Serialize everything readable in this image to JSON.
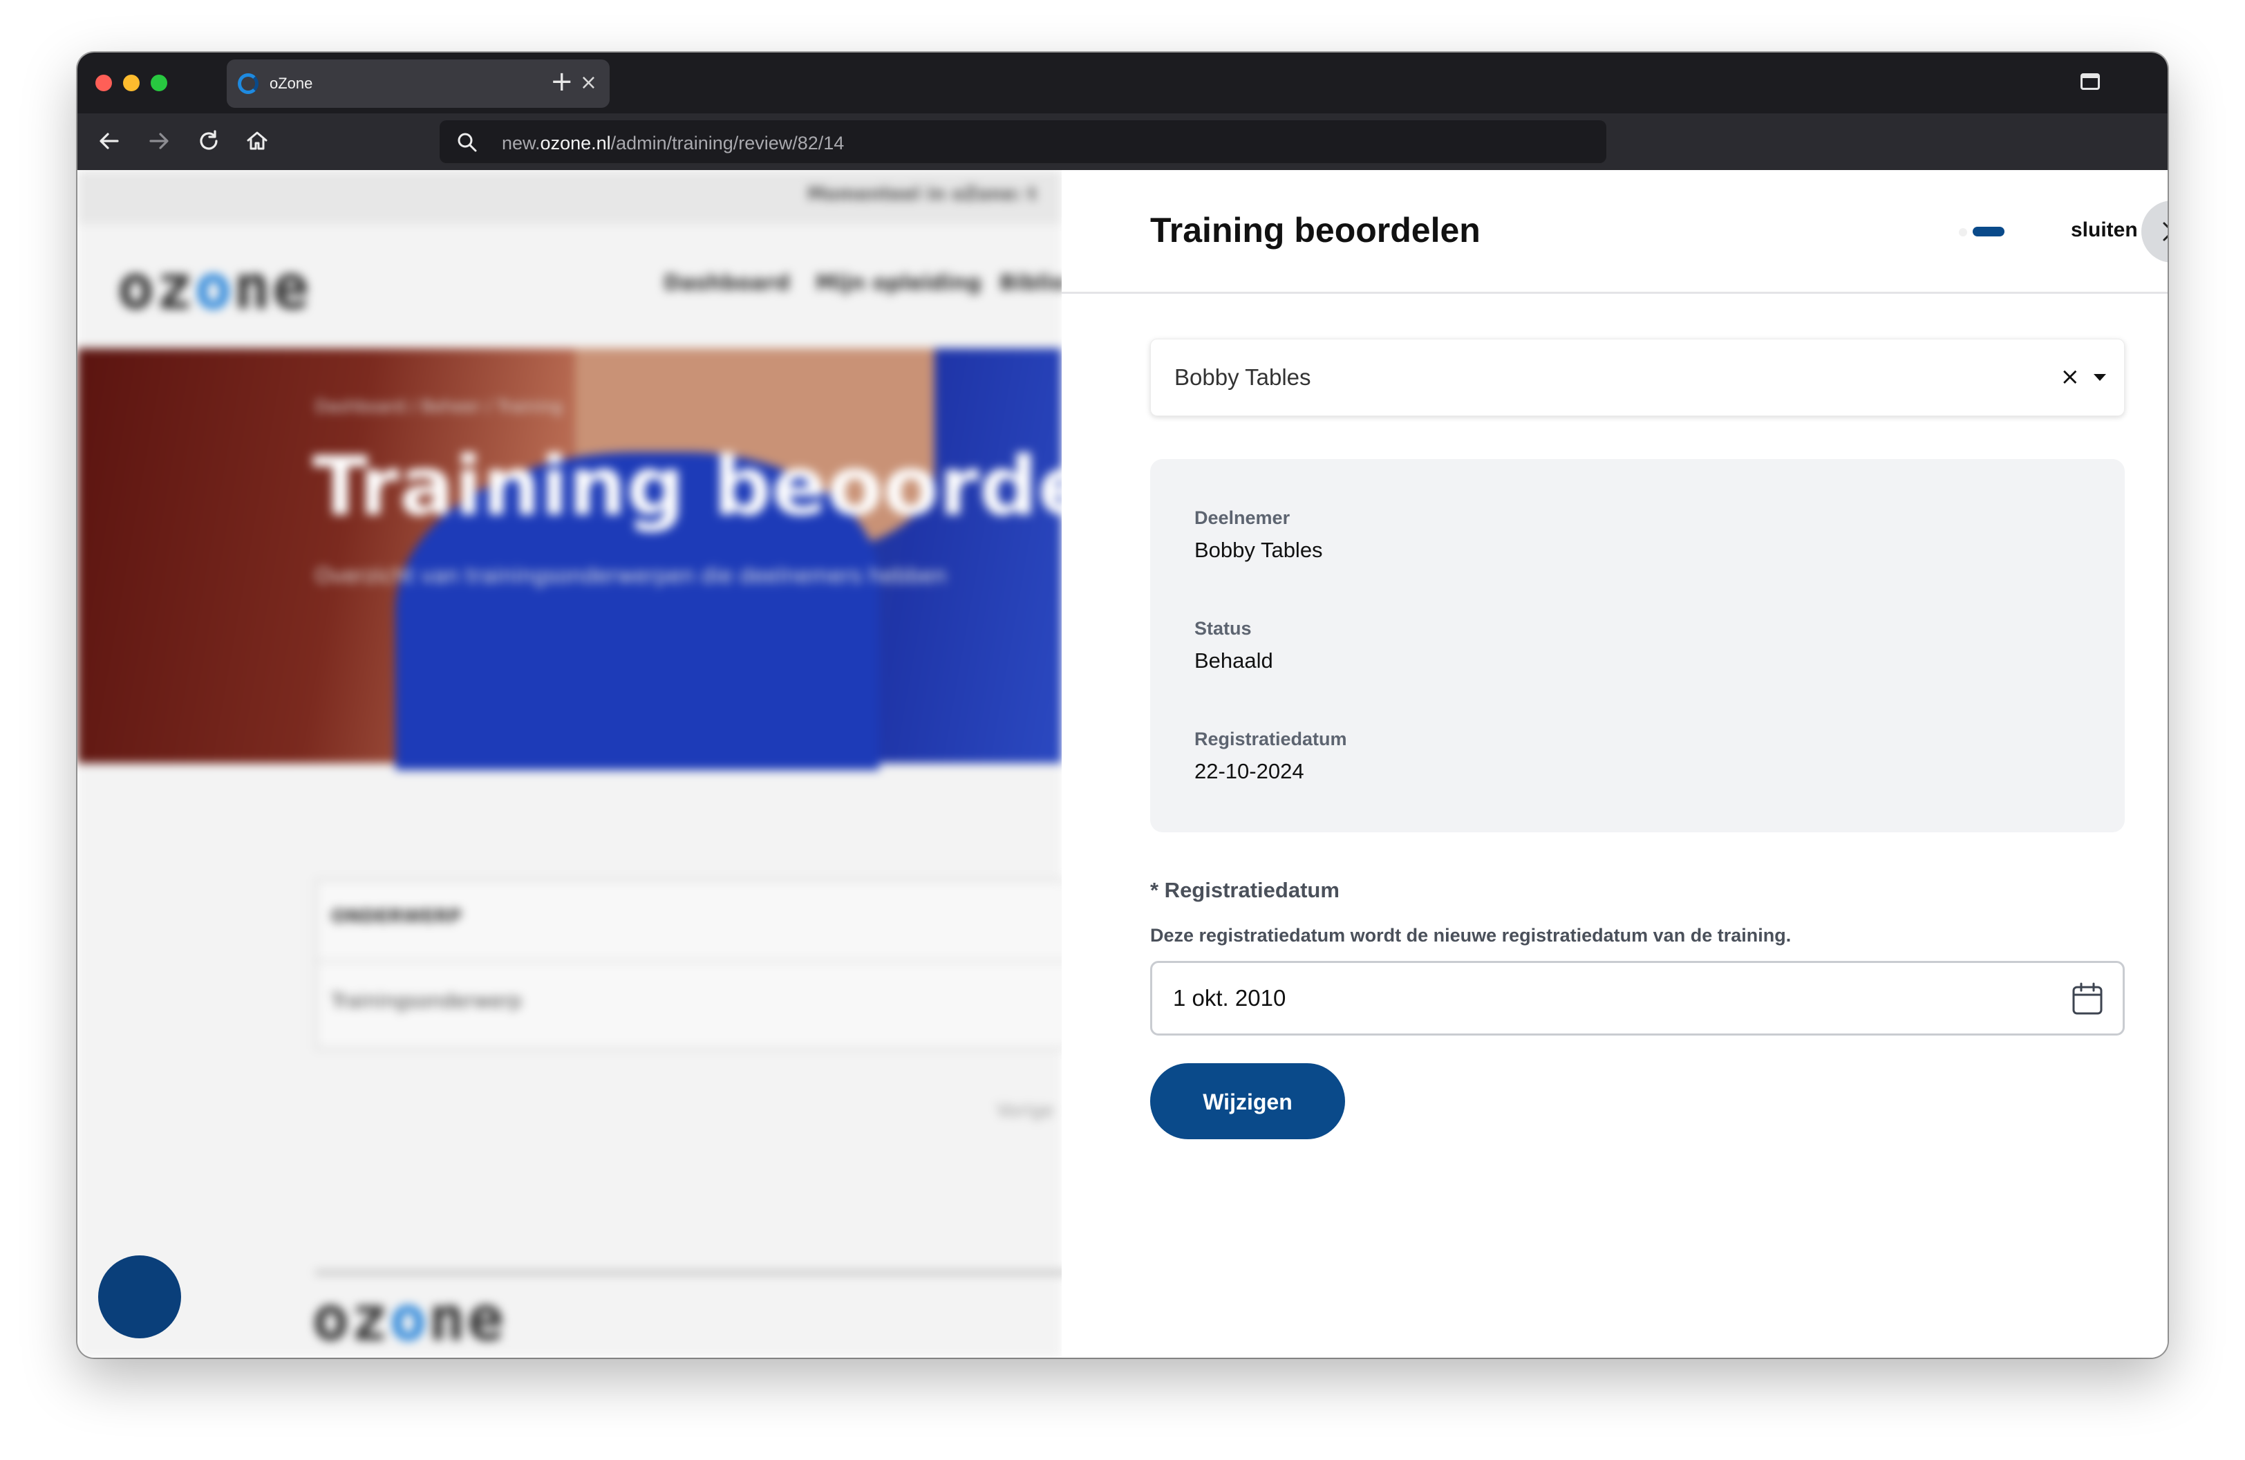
{
  "browser": {
    "tab_title": "oZone",
    "url_prefix": "new.",
    "url_host": "ozone.nl",
    "url_path": "/admin/training/review/82/14"
  },
  "background_page": {
    "banner": "Momenteel in oZone: t",
    "logo": "ozone",
    "nav": [
      "Dashboard",
      "Mijn opleiding",
      "Biblio"
    ],
    "breadcrumb": "Dashboard / Beheer / Training",
    "hero_title": "Training beoordelen",
    "hero_subtitle": "Overzicht van trainingsonderwerpen die deelnemers hebben",
    "table_header": "ONDERWERP",
    "table_cell": "Trainingsonderwerp",
    "pagination_prev": "Vorige",
    "footer_logo": "ozone"
  },
  "drawer": {
    "title": "Training beoordelen",
    "close_label": "sluiten",
    "participant_select": {
      "value": "Bobby Tables",
      "clear": "×"
    },
    "info": {
      "participant_label": "Deelnemer",
      "participant_value": "Bobby Tables",
      "status_label": "Status",
      "status_value": "Behaald",
      "date_label": "Registratiedatum",
      "date_value": "22-10-2024"
    },
    "form": {
      "date_field_label": "* Registratiedatum",
      "date_field_help": "Deze registratiedatum wordt de nieuwe registratiedatum van de training.",
      "date_field_value": "1 okt. 2010",
      "submit_label": "Wijzigen"
    }
  },
  "colors": {
    "primary": "#0a4a8a",
    "card_bg": "#f2f3f5",
    "chrome_bg": "#1c1c20"
  }
}
